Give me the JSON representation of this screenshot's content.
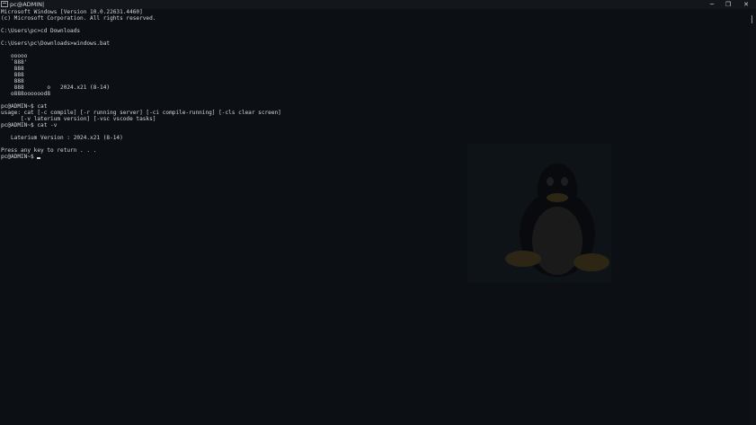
{
  "window": {
    "title": "pc@ADMIN|",
    "controls": {
      "minimize": "─",
      "restore": "❐",
      "close": "✕"
    }
  },
  "console": {
    "lines": [
      "Microsoft Windows [Version 10.0.22631.4460]",
      "(c) Microsoft Corporation. All rights reserved.",
      "",
      "C:\\Users\\pc>cd Downloads",
      "",
      "C:\\Users\\pc\\Downloads>windows.bat",
      "",
      "   ooooo",
      "   `888'",
      "    888",
      "    888",
      "    888",
      "    888       o   2024.x21 (8-14)",
      "   o888ooooood8",
      "",
      "pc@ADMIN~$ cat",
      "usage: cat [-c compile] [-r running server] [-ci compile-running] [-cls clear screen]",
      "      [-v laterium version] [-vsc vscode tasks]",
      "pc@ADMIN~$ cat -v",
      "",
      "   Laterium Version : 2024.x21 (8-14)",
      "",
      "Press any key to return . . .",
      "pc@ADMIN~$ "
    ]
  },
  "colors": {
    "background": "#0c1014",
    "text": "#d3d7db",
    "titlebar": "#13171b"
  },
  "icons": {
    "terminal": "terminal-icon",
    "wallpaper": "tux-penguin-icon"
  }
}
